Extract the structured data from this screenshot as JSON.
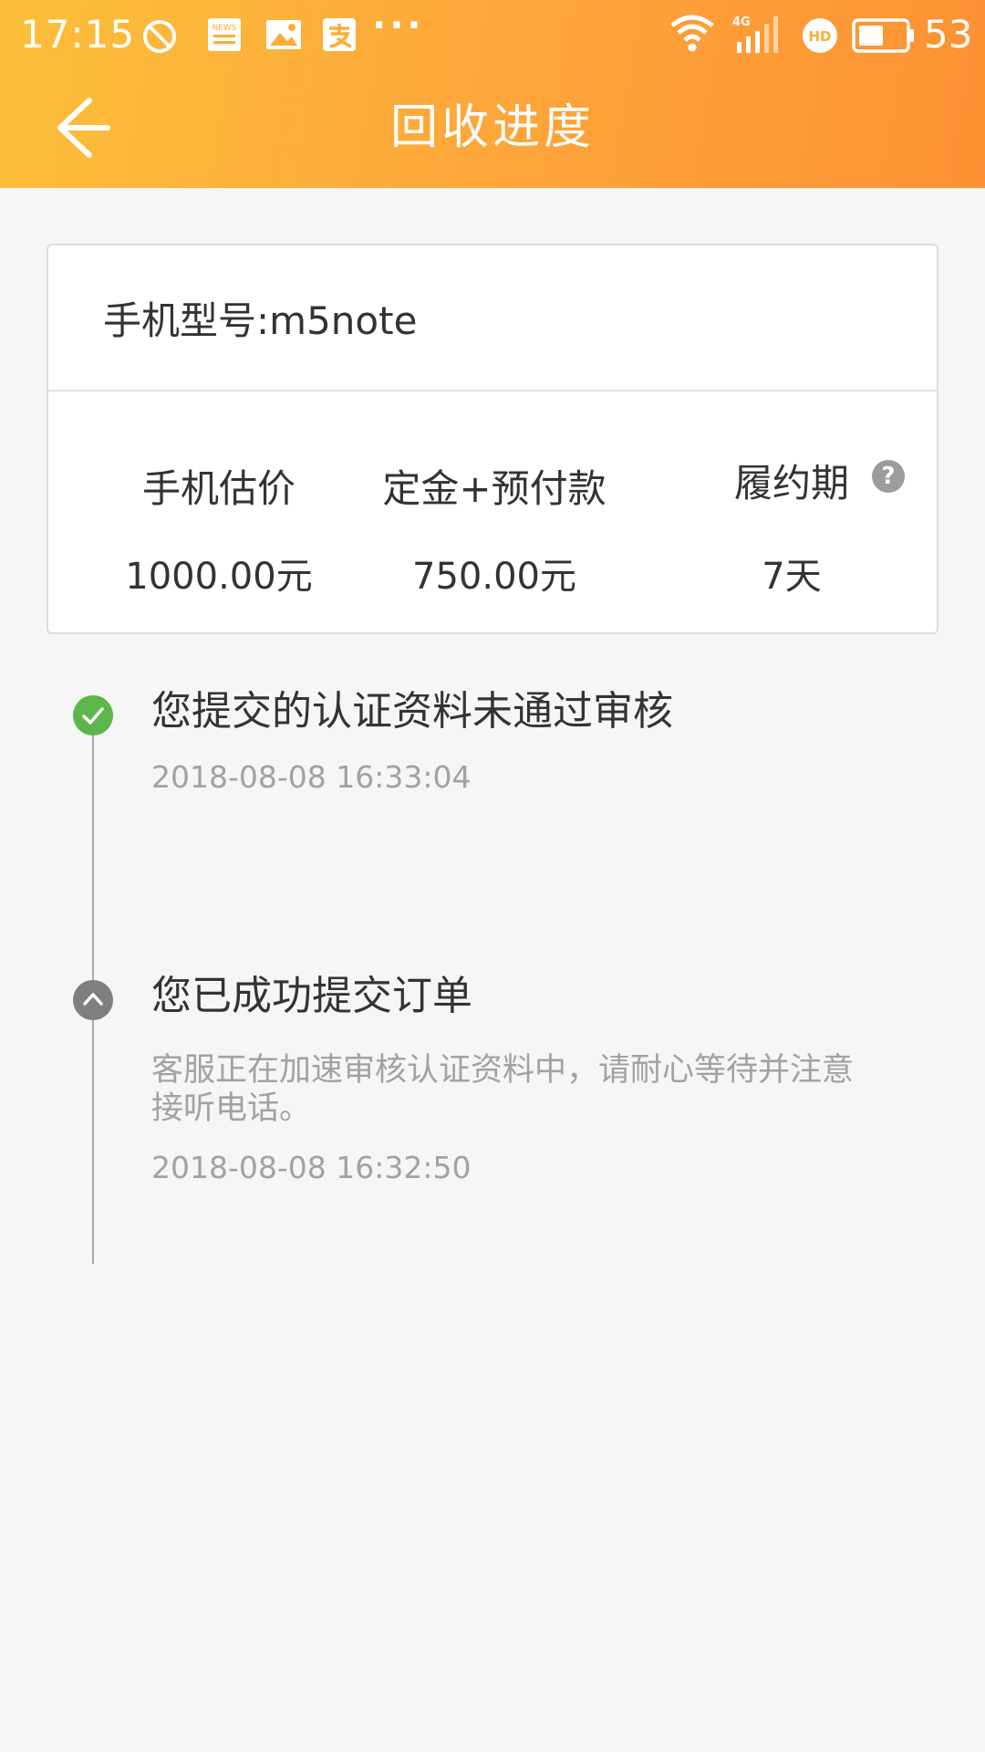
{
  "status_bar": {
    "time": "17:15",
    "battery_percent": "53",
    "icons": [
      "block-icon",
      "news-icon",
      "image-icon",
      "alipay-icon",
      "more-dots-icon",
      "wifi-icon",
      "signal-4g-icon",
      "hd-icon",
      "battery-icon"
    ],
    "more_dots": "···",
    "signal_label": "4G",
    "hd_label": "HD",
    "news_label": "NEWS"
  },
  "header": {
    "title": "回收进度",
    "back_icon": "back-arrow-icon",
    "background_start": "#fcbf3a",
    "background_end": "#fd9133"
  },
  "card": {
    "model_label": "手机型号:m5note",
    "columns": [
      {
        "label": "手机估价",
        "value": "1000.00元"
      },
      {
        "label": "定金+预付款",
        "value": "750.00元"
      },
      {
        "label": "履约期",
        "value": "7天"
      }
    ],
    "help_glyph": "?"
  },
  "timeline": [
    {
      "status": "completed",
      "icon": "check-icon",
      "color": "#5cb64a",
      "title": "您提交的认证资料未通过审核",
      "description": "",
      "time": "2018-08-08 16:33:04"
    },
    {
      "status": "past",
      "icon": "chevron-up-icon",
      "color": "#7f7f7f",
      "title": "您已成功提交订单",
      "description": "客服正在加速审核认证资料中，请耐心等待并注意接听电话。",
      "time": "2018-08-08 16:32:50"
    }
  ]
}
